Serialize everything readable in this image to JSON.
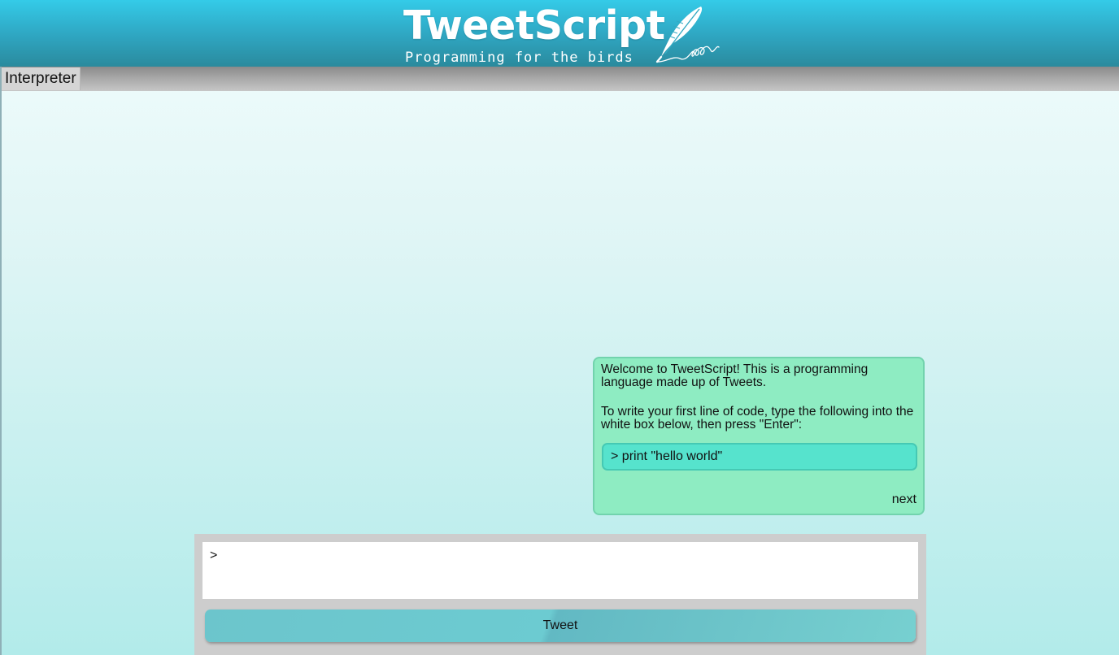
{
  "header": {
    "title": "TweetScript",
    "tagline": "Programming for the birds",
    "logo_icon": "quill-icon"
  },
  "nav": {
    "tabs": [
      {
        "label": "Interpreter",
        "active": true
      }
    ]
  },
  "tutorial": {
    "paragraphs": [
      "Welcome to TweetScript! This is a programming language made up of Tweets.",
      "To write your first line of code, type the following into the white box below, then press \"Enter\":"
    ],
    "code_example": "> print \"hello world\"",
    "next_label": "next"
  },
  "console": {
    "input_value": ">",
    "tweet_label": "Tweet"
  },
  "colors": {
    "header_top": "#34cbe8",
    "header_bottom": "#2a8a9d",
    "tutorial_bg": "#8eecc2",
    "code_bg": "#56e3cd",
    "button_bg": "#6cc5cc",
    "console_bg": "#cdcdcd"
  }
}
